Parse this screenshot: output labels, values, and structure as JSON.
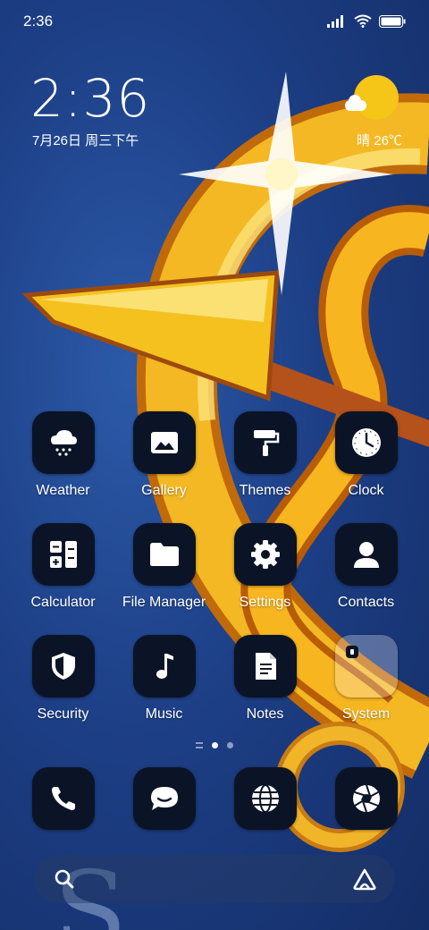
{
  "status_bar": {
    "time": "2:36"
  },
  "clock_widget": {
    "time": "2:36",
    "date": "7月26日 周三下午"
  },
  "weather_widget": {
    "text": "晴 26℃"
  },
  "apps": [
    {
      "label": "Weather",
      "icon": "weather-snow-icon"
    },
    {
      "label": "Gallery",
      "icon": "gallery-icon"
    },
    {
      "label": "Themes",
      "icon": "paint-roller-icon"
    },
    {
      "label": "Clock",
      "icon": "clock-icon"
    },
    {
      "label": "Calculator",
      "icon": "calculator-icon"
    },
    {
      "label": "File Manager",
      "icon": "folder-icon"
    },
    {
      "label": "Settings",
      "icon": "gear-icon"
    },
    {
      "label": "Contacts",
      "icon": "person-icon"
    },
    {
      "label": "Security",
      "icon": "shield-icon"
    },
    {
      "label": "Music",
      "icon": "music-note-icon"
    },
    {
      "label": "Notes",
      "icon": "note-icon"
    },
    {
      "label": "System",
      "icon": "folder-system-icon"
    }
  ],
  "dock": [
    {
      "icon": "phone-icon"
    },
    {
      "icon": "message-icon"
    },
    {
      "icon": "globe-icon"
    },
    {
      "icon": "camera-aperture-icon"
    }
  ],
  "page_indicator": {
    "pages": 2,
    "active": 1
  },
  "colors": {
    "wallpaper_blue": "#1d3f86",
    "sun_yellow": "#f5c518",
    "tile_dark": "#0b1426"
  }
}
